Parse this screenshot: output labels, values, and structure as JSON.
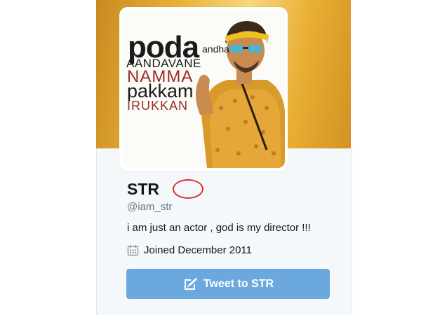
{
  "profile": {
    "name": "STR",
    "handle": "@iam_str",
    "bio": "i am just an actor , god is my director !!!",
    "joined": "Joined December 2011"
  },
  "avatar_text": {
    "line1": "poda",
    "line1_small": "andha",
    "line2": "AANDAVANE",
    "line3": "NAMMA",
    "line4": "pakkam",
    "line5": "IRUKKAN"
  },
  "actions": {
    "tweet_label": "Tweet to STR"
  },
  "icons": {
    "joined": "calendar-icon",
    "tweet": "compose-tweet-icon",
    "annotation": "red-circle-annotation"
  },
  "colors": {
    "banner": "#e9b23a",
    "button": "#6ba8de",
    "annotation_circle": "#d8322a",
    "handle_text": "#657786"
  }
}
